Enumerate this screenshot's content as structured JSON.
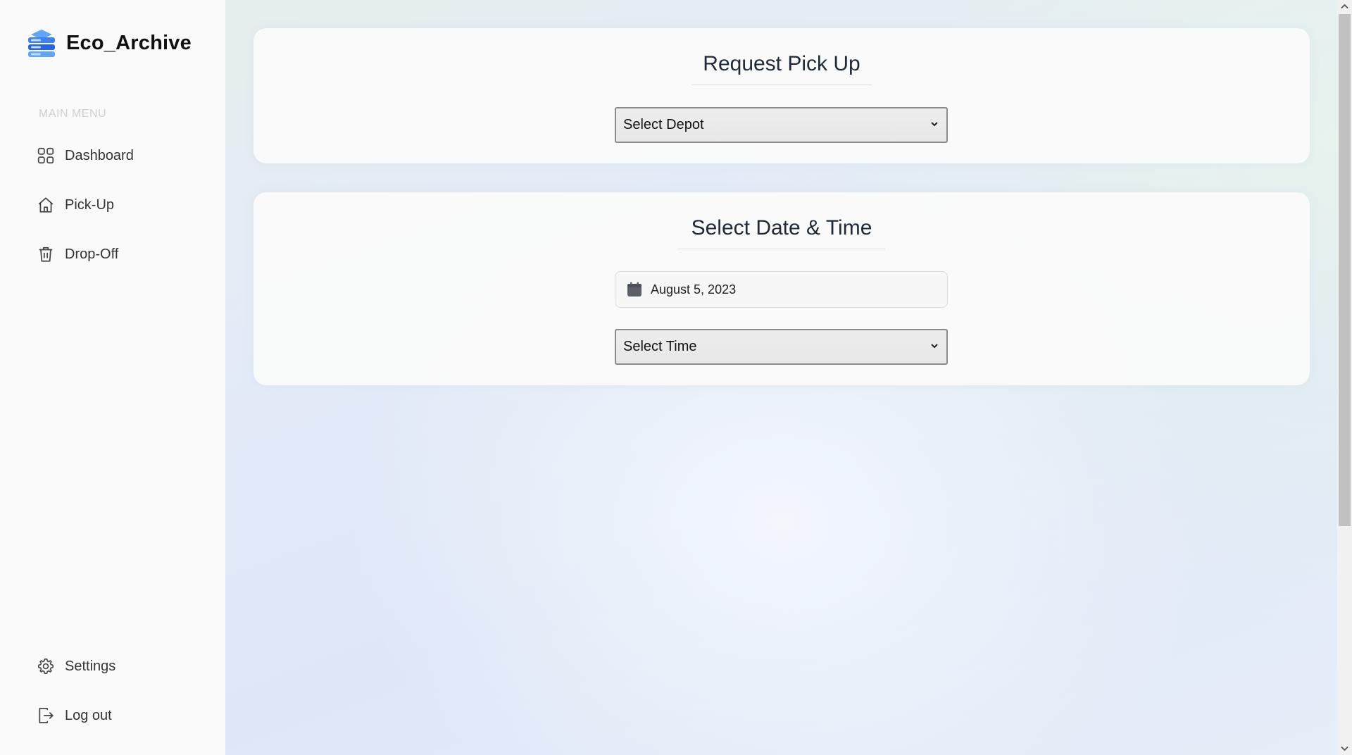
{
  "brand": {
    "name": "Eco_Archive",
    "logo_icon": "stacked-server-icon"
  },
  "sidebar": {
    "heading": "MAIN MENU",
    "items": [
      {
        "label": "Dashboard",
        "icon": "grid-icon"
      },
      {
        "label": "Pick-Up",
        "icon": "home-icon"
      },
      {
        "label": "Drop-Off",
        "icon": "trash-icon"
      }
    ],
    "bottom_items": [
      {
        "label": "Settings",
        "icon": "gear-icon"
      },
      {
        "label": "Log out",
        "icon": "logout-icon"
      }
    ]
  },
  "pickup_card": {
    "title": "Request Pick Up",
    "depot_select": {
      "selected": "Select Depot"
    }
  },
  "datetime_card": {
    "title": "Select Date & Time",
    "date_value": "August 5, 2023",
    "time_select": {
      "selected": "Select Time"
    }
  },
  "colors": {
    "logo_blue": "#3b82f6",
    "logo_light": "#93c5fd",
    "sidebar_bg": "#fafafa",
    "card_bg": "#fafafa"
  }
}
